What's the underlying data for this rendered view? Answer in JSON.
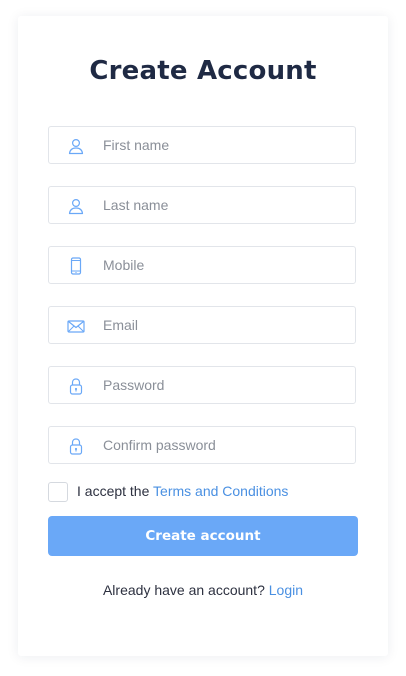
{
  "form": {
    "title": "Create Account",
    "fields": [
      {
        "placeholder": "First name",
        "icon": "user-icon"
      },
      {
        "placeholder": "Last name",
        "icon": "user-icon"
      },
      {
        "placeholder": "Mobile",
        "icon": "mobile-icon"
      },
      {
        "placeholder": "Email",
        "icon": "envelope-icon"
      },
      {
        "placeholder": "Password",
        "icon": "lock-icon"
      },
      {
        "placeholder": "Confirm password",
        "icon": "lock-icon"
      }
    ],
    "terms_prefix": "I accept the",
    "terms_link": "Terms and Conditions",
    "terms_checked": false,
    "submit_label": "Create account",
    "footer_text": "Already have an account?",
    "footer_link": "Login"
  },
  "colors": {
    "title": "#1f2a44",
    "accent": "#4a90e2",
    "button": "#6aa8f7",
    "border": "#e2e5ea"
  }
}
